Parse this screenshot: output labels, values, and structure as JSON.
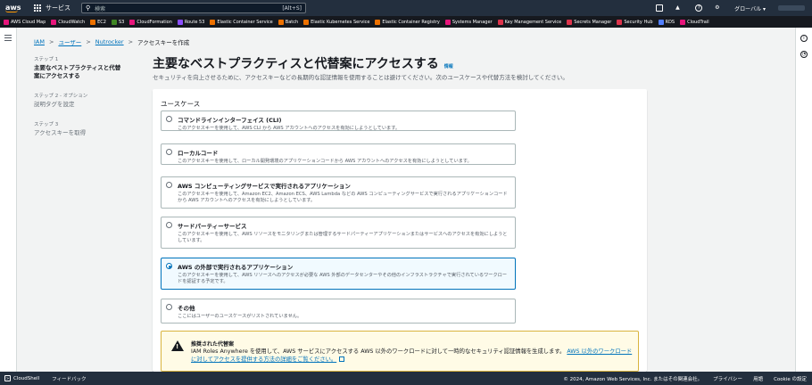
{
  "topbar": {
    "logo": "aws",
    "services_label": "サービス",
    "search_placeholder": "検索",
    "search_shortcut": "[Alt+S]",
    "region_label": "グローバル ▾"
  },
  "favorites": [
    {
      "label": "AWS Cloud Map",
      "color": "#e7157b"
    },
    {
      "label": "CloudWatch",
      "color": "#e7157b"
    },
    {
      "label": "EC2",
      "color": "#ed7100"
    },
    {
      "label": "S3",
      "color": "#3f8624"
    },
    {
      "label": "CloudFormation",
      "color": "#e7157b"
    },
    {
      "label": "Route 53",
      "color": "#8c4fff"
    },
    {
      "label": "Elastic Container Service",
      "color": "#ed7100"
    },
    {
      "label": "Batch",
      "color": "#ed7100"
    },
    {
      "label": "Elastic Kubernetes Service",
      "color": "#ed7100"
    },
    {
      "label": "Elastic Container Registry",
      "color": "#ed7100"
    },
    {
      "label": "Systems Manager",
      "color": "#e7157b"
    },
    {
      "label": "Key Management Service",
      "color": "#dd344c"
    },
    {
      "label": "Secrets Manager",
      "color": "#dd344c"
    },
    {
      "label": "Security Hub",
      "color": "#dd344c"
    },
    {
      "label": "RDS",
      "color": "#527fff"
    },
    {
      "label": "CloudTrail",
      "color": "#e7157b"
    }
  ],
  "breadcrumb": {
    "items": [
      "IAM",
      "ユーザー",
      "Nutrocker"
    ],
    "current": "アクセスキーを作成"
  },
  "steps": [
    {
      "num": "ステップ 1",
      "label": "主要なベストプラクティスと代替案にアクセスする"
    },
    {
      "num": "ステップ 2 - オプション",
      "label": "説明タグを設定"
    },
    {
      "num": "ステップ 3",
      "label": "アクセスキーを取得"
    }
  ],
  "page": {
    "title": "主要なベストプラクティスと代替案にアクセスする",
    "info_link": "情報",
    "subtitle": "セキュリティを向上させるために、アクセスキーなどの長期的な認証情報を使用することは避けてください。次のユースケースや代替方法を検討してください。"
  },
  "usecase": {
    "heading": "ユースケース",
    "options": [
      {
        "title": "コマンドラインインターフェイス (CLI)",
        "desc": "このアクセスキーを使用して、AWS CLI から AWS アカウントへのアクセスを有効にしようとしています。",
        "selected": false
      },
      {
        "title": "ローカルコード",
        "desc": "このアクセスキーを使用して、ローカル開発環境のアプリケーションコードから AWS アカウントへのアクセスを有効にしようとしています。",
        "selected": false
      },
      {
        "title": "AWS コンピューティングサービスで実行されるアプリケーション",
        "desc": "このアクセスキーを使用して、Amazon EC2、Amazon ECS、AWS Lambda などの AWS コンピューティングサービスで実行されるアプリケーションコードから AWS アカウントへのアクセスを有効にしようとしています。",
        "selected": false
      },
      {
        "title": "サードパーティーサービス",
        "desc": "このアクセスキーを使用して、AWS リソースをモニタリングまたは管理するサードパーティーアプリケーションまたはサービスへのアクセスを有効にしようとしています。",
        "selected": false
      },
      {
        "title": "AWS の外部で実行されるアプリケーション",
        "desc": "このアクセスキーを使用して、AWS リソースへのアクセスが必要な AWS 外部のデータセンターやその他のインフラストラクチャで実行されているワークロードを認証する予定です。",
        "selected": true
      },
      {
        "title": "その他",
        "desc": "ここにはユーザーのユースケースがリストされていません。",
        "selected": false
      }
    ]
  },
  "alert": {
    "title": "推奨された代替案",
    "text": "IAM Roles Anywhere を使用して、AWS サービスにアクセスする AWS 以外のワークロードに対して一時的なセキュリティ認証情報を生成します。",
    "link": "AWS 以外のワークロードに対してアクセスを提供する方法の詳細をご覧ください。"
  },
  "footer": {
    "cloudshell": "CloudShell",
    "feedback": "フィードバック",
    "copyright": "© 2024, Amazon Web Services, Inc. またはその関連会社。",
    "privacy": "プライバシー",
    "terms": "用語",
    "cookie": "Cookie の設定"
  }
}
